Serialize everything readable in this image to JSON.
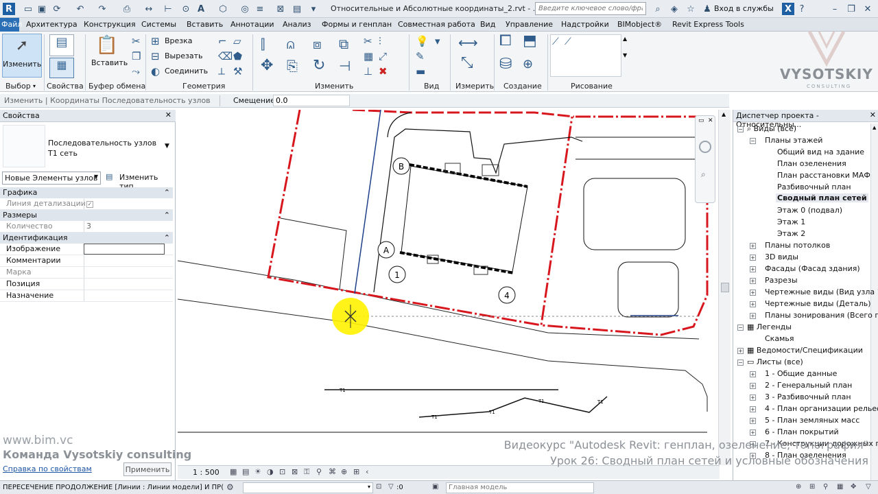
{
  "title_bar": {
    "document_title": "Относительные и Абсолютные координаты_2.rvt - ...",
    "search_placeholder": "Введите ключевое слово/фразу",
    "login_label": "Вход в службы"
  },
  "tabs": {
    "file": "Файл",
    "items": [
      "Архитектура",
      "Конструкция",
      "Системы",
      "Вставить",
      "Аннотации",
      "Анализ",
      "Формы и генплан",
      "Совместная работа",
      "Вид",
      "Управление",
      "Надстройки",
      "BIMobject®",
      "Revit Express Tools"
    ]
  },
  "ribbon": {
    "modify_label": "Изменить",
    "select_panel": "Выбор",
    "properties_panel": "Свойства",
    "clipboard_paste": "Вставить",
    "clipboard_panel": "Буфер обмена",
    "geometry_cut": "Врезка",
    "geometry_cut2": "Вырезать",
    "geometry_join": "Соединить",
    "geometry_panel": "Геометрия",
    "modify_panel": "Изменить",
    "view_panel": "Вид",
    "measure_panel": "Измерить",
    "create_panel": "Создание",
    "draw_panel": "Рисование"
  },
  "options_bar": {
    "context": "Изменить | Координаты Последовательность узлов",
    "offset_label": "Смещение:",
    "offset_value": "0.0"
  },
  "properties": {
    "title": "Свойства",
    "type_name_1": "Последовательность узлов",
    "type_name_2": "T1 сеть",
    "filter_value": "Новые Элементы узлов",
    "edit_type": "Изменить тип",
    "sections": {
      "graphics": "Графика",
      "dimensions": "Размеры",
      "identity": "Идентификация"
    },
    "rows": {
      "detail_line": "Линия детализации",
      "count": "Количество",
      "count_value": "3",
      "image": "Изображение",
      "comments": "Комментарии",
      "mark": "Марка",
      "position": "Позиция",
      "purpose": "Назначение"
    },
    "help_link": "Справка по свойствам",
    "apply_button": "Применить"
  },
  "drawing": {
    "grid_labels": [
      "B",
      "A",
      "1",
      "4"
    ],
    "pipe_tag": "T1"
  },
  "browser": {
    "title": "Диспетчер проекта - Относительны...",
    "items": {
      "views_all": "Виды (все)",
      "floor_plans": "Планы этажей",
      "fp_overall": "Общий вид на здание",
      "fp_landscape": "План озеленения",
      "fp_maf": "План расстановки МАФ",
      "fp_layout": "Разбивочный план",
      "fp_networks": "Сводный план сетей",
      "fp_basement": "Этаж 0 (подвал)",
      "fp_level1": "Этаж 1",
      "fp_level2": "Этаж 2",
      "ceiling_plans": "Планы потолков",
      "views_3d": "3D виды",
      "elevations": "Фасады (Фасад здания)",
      "sections": "Разрезы",
      "drafting_node": "Чертежные виды (Вид узла 1",
      "drafting_detail": "Чертежные виды (Деталь)",
      "zoning_plans": "Планы зонирования (Всего п",
      "legends": "Легенды",
      "bench": "Скамья",
      "schedules": "Ведомости/Спецификации",
      "sheets_all": "Листы (все)",
      "s1": "1 - Общие данные",
      "s2": "2 - Генеральный план",
      "s3": "3 - Разбивочный план",
      "s4": "4 - План организации рельеф",
      "s5": "5 - План земляных масс",
      "s6": "6 - План покрытий",
      "s7": "7 - Конструкции дорожных п",
      "s8": "8 - План озеленения"
    }
  },
  "view_bar": {
    "scale": "1 : 500"
  },
  "status_bar": {
    "message": "ПЕРЕСЕЧЕНИЕ ПРОДОЛЖЕНИЕ [Линии : Линии модели] И ПР(",
    "model_label": "Главная модель",
    "selection_count": ":0"
  },
  "overlay": {
    "watermark_site": "www.bim.vc",
    "watermark_team": "Команда Vysotskiy consulting",
    "course_title": "Видеокурс \"Autodesk Revit: генплан, озеленение, топография\"",
    "lesson_title": "Урок 26: Сводный план сетей и условные обозначения",
    "logo_name": "VYSOTSKIY",
    "logo_sub": "CONSULTING"
  }
}
